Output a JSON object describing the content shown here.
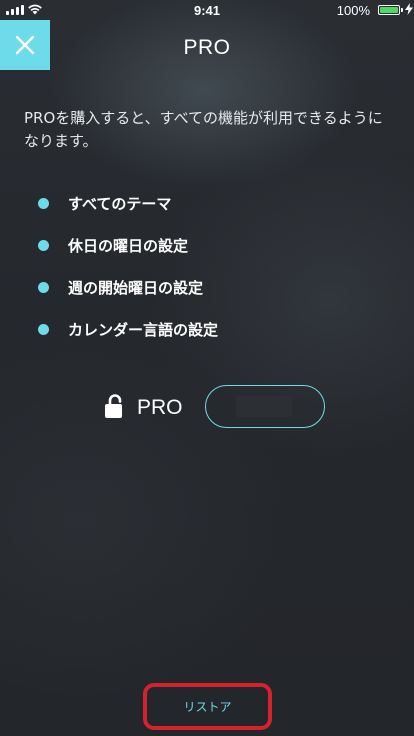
{
  "status_bar": {
    "time": "9:41",
    "battery_percent": "100%",
    "battery_level": 1.0,
    "battery_color": "#4cd964"
  },
  "header": {
    "title": "PRO",
    "close_icon": "close-icon"
  },
  "description": "PROを購入すると、すべての機能が利用できるようになります。",
  "features": [
    {
      "label": "すべてのテーマ"
    },
    {
      "label": "休日の曜日の設定"
    },
    {
      "label": "週の開始曜日の設定"
    },
    {
      "label": "カレンダー言語の設定"
    }
  ],
  "purchase": {
    "lock_icon": "unlocked-padlock-icon",
    "label": "PRO"
  },
  "restore": {
    "label": "リストア"
  },
  "colors": {
    "accent": "#6ddbea",
    "background": "#26292e",
    "highlight": "#d5222c"
  }
}
